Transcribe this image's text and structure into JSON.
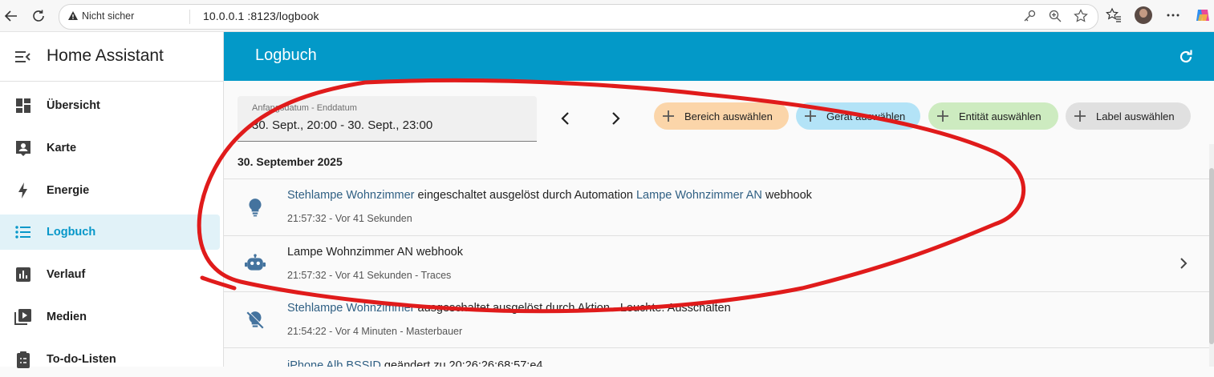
{
  "browser": {
    "insecure_label": "Nicht sicher",
    "url": "10.0.0.1  :8123/logbook"
  },
  "sidebar": {
    "title": "Home Assistant",
    "items": [
      {
        "label": "Übersicht",
        "icon": "dashboard-icon"
      },
      {
        "label": "Karte",
        "icon": "map-account-icon"
      },
      {
        "label": "Energie",
        "icon": "lightning-bolt-icon"
      },
      {
        "label": "Logbuch",
        "icon": "format-list-bulleted-icon",
        "active": true
      },
      {
        "label": "Verlauf",
        "icon": "chart-box-icon"
      },
      {
        "label": "Medien",
        "icon": "play-box-multiple-icon"
      },
      {
        "label": "To-do-Listen",
        "icon": "clipboard-list-icon"
      }
    ]
  },
  "header": {
    "title": "Logbuch"
  },
  "date_range": {
    "label": "Anfangsdatum - Enddatum",
    "value": "30. Sept., 20:00 - 30. Sept., 23:00"
  },
  "filters": {
    "area": "Bereich auswählen",
    "device": "Gerät auswählen",
    "entity": "Entität auswählen",
    "label": "Label auswählen"
  },
  "day_header": "30. September 2025",
  "entries": [
    {
      "entity": "Stehlampe Wohnzimmer",
      "text1": " eingeschaltet ausgelöst durch Automation ",
      "link2": "Lampe Wohnzimmer AN",
      "text2": " webhook",
      "sub": "21:57:32 - Vor 41 Sekunden",
      "icon": "lightbulb-icon"
    },
    {
      "text": "Lampe Wohnzimmer AN webhook",
      "sub": "21:57:32 - Vor 41 Sekunden - Traces",
      "icon": "robot-icon"
    },
    {
      "entity": "Stehlampe Wohnzimmer",
      "text1": " ausgeschaltet ausgelöst durch Aktion - Leuchte: Ausschalten",
      "sub": "21:54:22 - Vor 4 Minuten - Masterbauer",
      "icon": "lightbulb-off-icon"
    },
    {
      "entity": "iPhone Alb BSSID",
      "text1": " geändert zu 20:26:26:68:57:e4",
      "icon": "wifi-icon"
    }
  ],
  "colors": {
    "header_bg": "#0399c8",
    "active_text": "#0697c9",
    "link": "#2f5f83",
    "chip_area": "#fbd5a9",
    "chip_device": "#b3e3f7",
    "chip_entity": "#cdebc0",
    "chip_label": "#e0e0e0",
    "annotation": "#e01b1b"
  }
}
